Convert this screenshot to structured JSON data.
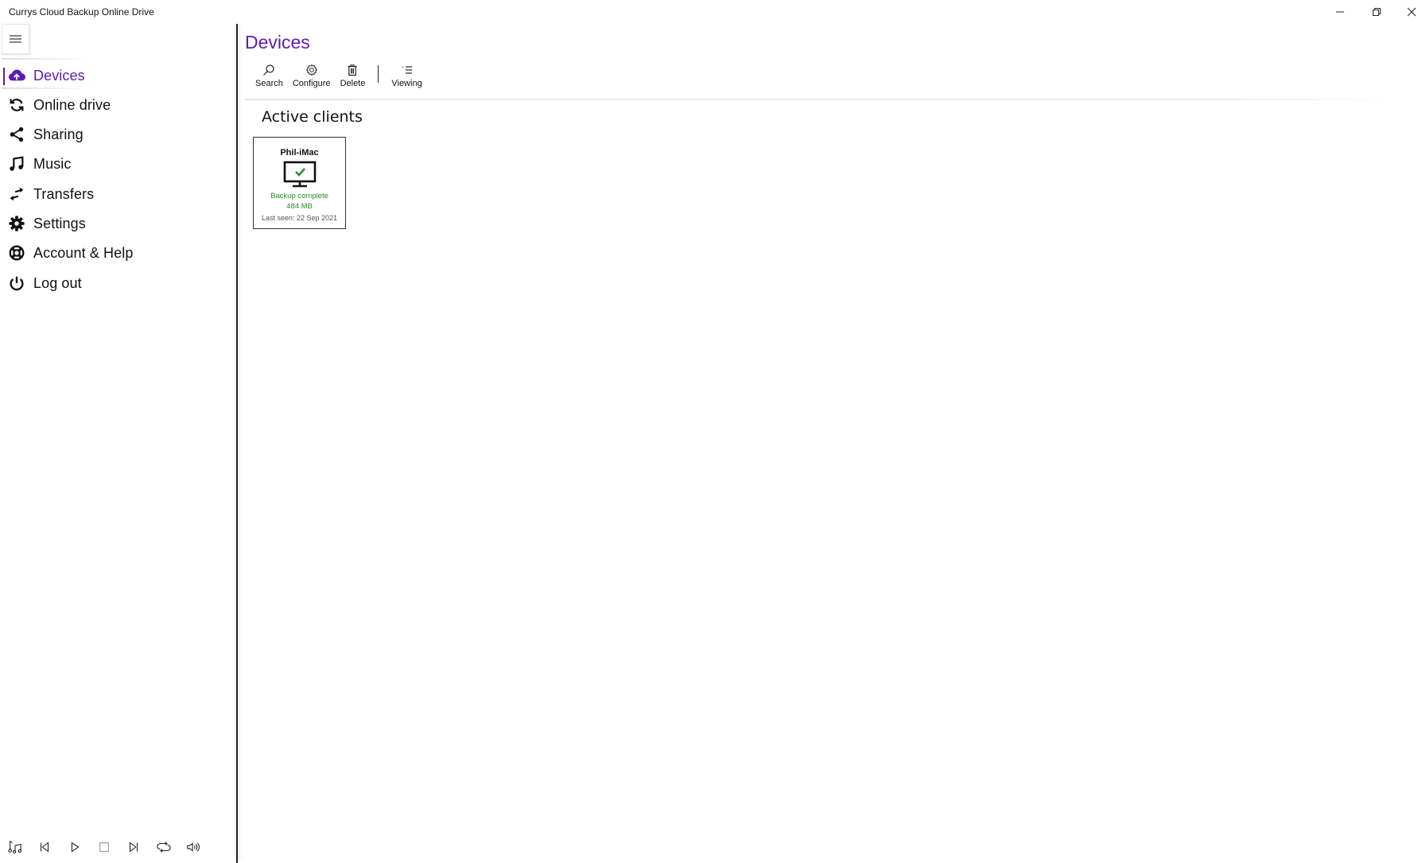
{
  "window": {
    "title": "Currys Cloud Backup Online Drive",
    "controls": [
      "minimize",
      "restore",
      "close"
    ]
  },
  "sidebar": {
    "menu_icon": "hamburger-icon",
    "items": [
      {
        "label": "Devices",
        "icon": "cloud-upload-icon",
        "active": true
      },
      {
        "label": "Online drive",
        "icon": "sync-icon",
        "active": false
      },
      {
        "label": "Sharing",
        "icon": "share-icon",
        "active": false
      },
      {
        "label": "Music",
        "icon": "music-note-icon",
        "active": false
      },
      {
        "label": "Transfers",
        "icon": "transfer-arrows-icon",
        "active": false
      },
      {
        "label": "Settings",
        "icon": "gear-icon",
        "active": false
      },
      {
        "label": "Account & Help",
        "icon": "lifebuoy-icon",
        "active": false
      },
      {
        "label": "Log out",
        "icon": "power-icon",
        "active": false
      }
    ],
    "media_controls": [
      "music-library",
      "previous",
      "play",
      "stop",
      "next",
      "repeat",
      "volume"
    ]
  },
  "main": {
    "title": "Devices",
    "toolbar": [
      {
        "label": "Search",
        "icon": "search-icon"
      },
      {
        "label": "Configure",
        "icon": "gear-outline-icon"
      },
      {
        "label": "Delete",
        "icon": "trash-icon"
      },
      {
        "label": "Viewing",
        "icon": "list-view-icon"
      }
    ],
    "section_title": "Active clients",
    "clients": [
      {
        "name": "Phil-iMac",
        "icon": "monitor-check-icon",
        "status": "Backup complete",
        "size": "484 MB",
        "last_seen": "Last seen: 22 Sep 2021"
      }
    ]
  },
  "colors": {
    "accent": "#5c1bb6",
    "success": "#2e8b2e"
  }
}
